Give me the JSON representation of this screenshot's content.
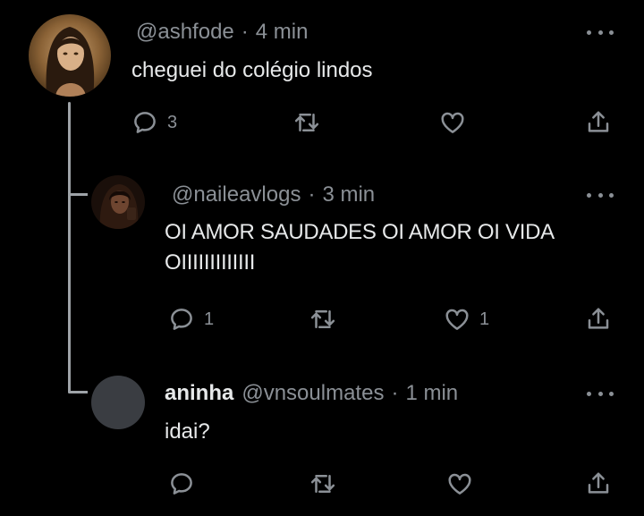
{
  "tweets": [
    {
      "handle": "@ashfode",
      "time": "4 min",
      "text": "cheguei do colégio lindos",
      "replies": "3",
      "retweets": "",
      "likes": ""
    },
    {
      "handle": "@naileavlogs",
      "time": "3 min",
      "text_line1": "OI AMOR SAUDADES OI AMOR OI VIDA",
      "text_line2": "OIIIIIIIIIIIII",
      "replies": "1",
      "retweets": "",
      "likes": "1"
    },
    {
      "display_name": "aninha",
      "handle": "@vnsoulmates",
      "time": "1 min",
      "text": "idai?",
      "replies": "",
      "retweets": "",
      "likes": ""
    }
  ],
  "separator": "·",
  "colors": {
    "background": "#000000",
    "text": "#e7e9ea",
    "muted": "#8b9096",
    "thread_line": "#9ea3a8"
  },
  "icons": [
    "reply-icon",
    "retweet-icon",
    "like-icon",
    "share-icon",
    "more-icon"
  ]
}
